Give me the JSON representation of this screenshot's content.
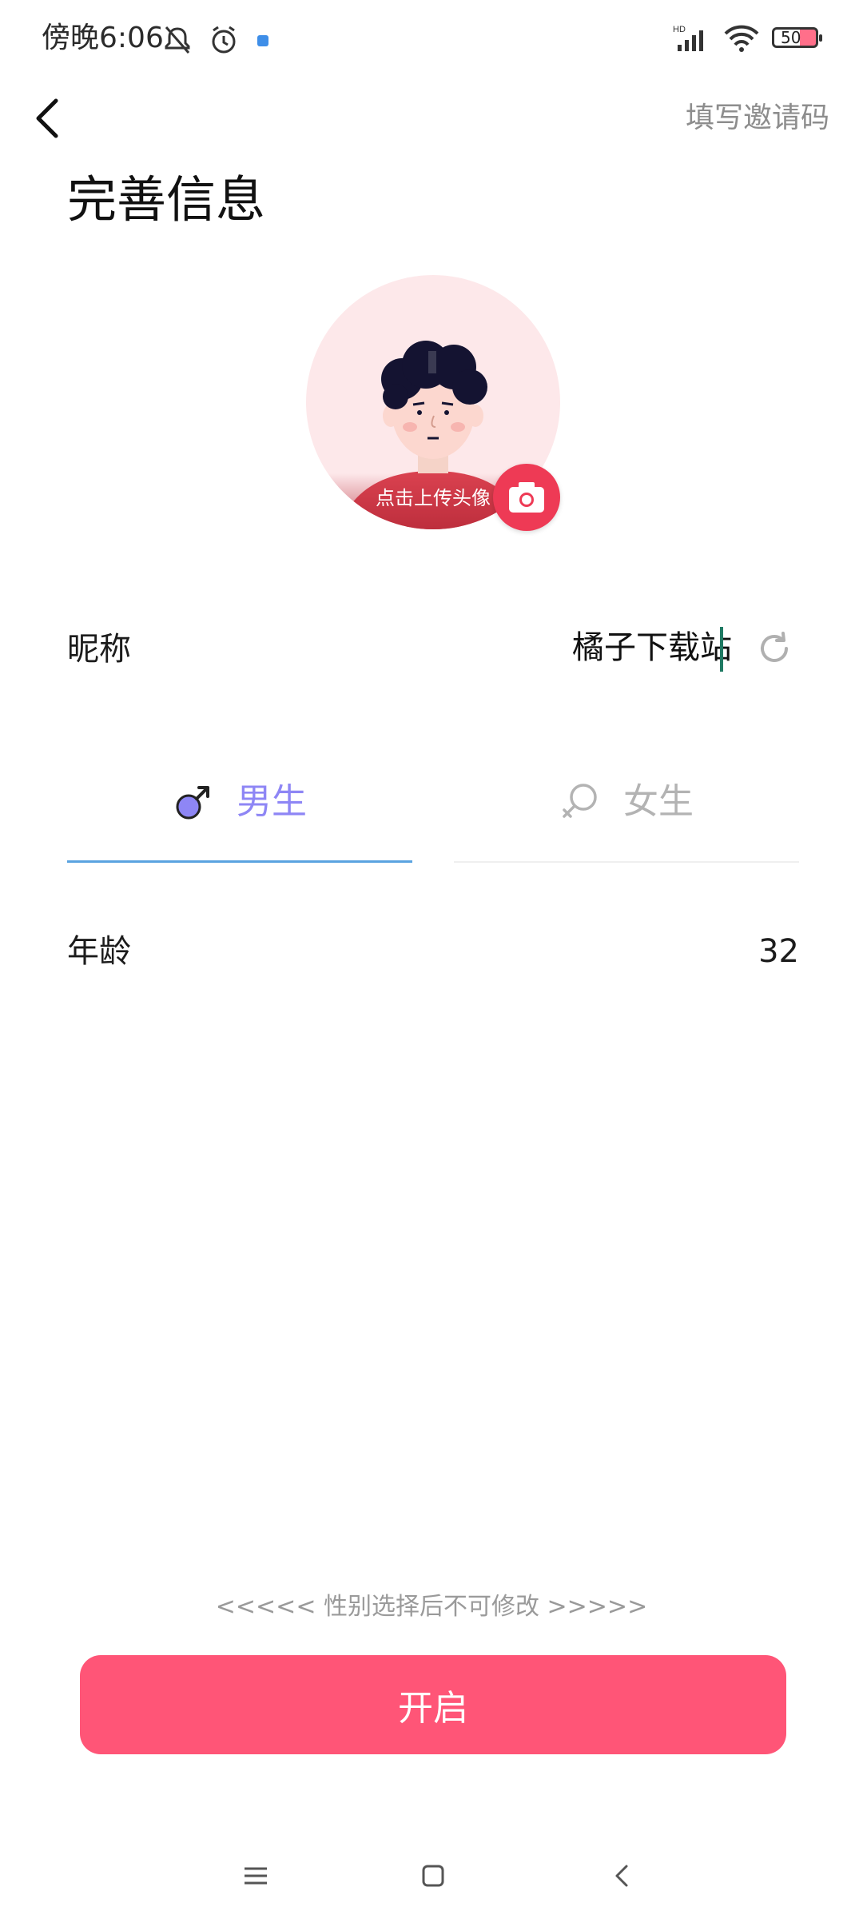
{
  "status_bar": {
    "time": "傍晚6:06",
    "battery": "50",
    "icons": [
      "mute-icon",
      "alarm-icon",
      "app-notification-icon",
      "hd-signal-icon",
      "wifi-icon",
      "battery-icon"
    ]
  },
  "header": {
    "invite_label": "填写邀请码",
    "title": "完善信息"
  },
  "avatar": {
    "upload_label": "点击上传头像",
    "camera_icon": "camera-icon"
  },
  "nickname": {
    "label": "昵称",
    "value": "橘子下载站",
    "refresh_icon": "refresh-icon"
  },
  "gender": {
    "options": [
      {
        "label": "男生",
        "icon": "male-icon",
        "selected": true
      },
      {
        "label": "女生",
        "icon": "female-icon",
        "selected": false
      }
    ]
  },
  "age": {
    "label": "年龄",
    "value": "32"
  },
  "notice": "<<<<< 性别选择后不可修改 >>>>>",
  "primary_button": "开启",
  "colors": {
    "accent_pink": "#ff5577",
    "camera_red": "#ee3a55",
    "selected_tab": "#8e86f5",
    "tab_underline": "#5aa3e0"
  },
  "nav_bar": [
    "menu-icon",
    "home-icon",
    "back-nav-icon"
  ]
}
